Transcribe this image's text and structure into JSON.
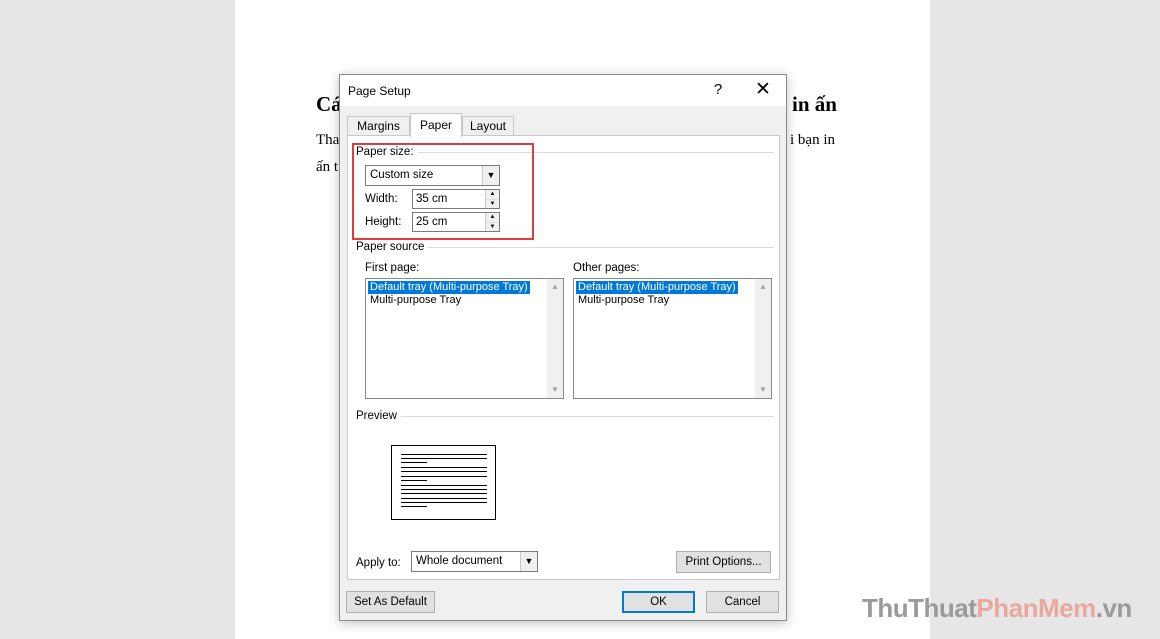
{
  "document": {
    "heading_left": "Cá",
    "heading_right": "in ấn",
    "line1_left": "Tha",
    "line2_left": "ấn t",
    "line1_right": "i bạn in"
  },
  "dialog": {
    "title": "Page Setup",
    "help_label": "?",
    "close_label": "✕",
    "tabs": [
      {
        "label": "Margins",
        "active": false
      },
      {
        "label": "Paper",
        "active": true
      },
      {
        "label": "Layout",
        "active": false
      }
    ],
    "paper_size": {
      "group_label": "Paper size:",
      "selected": "Custom size",
      "width_label": "Width:",
      "width_value": "35 cm",
      "height_label": "Height:",
      "height_value": "25 cm",
      "highlight_color": "#e03c3c"
    },
    "paper_source": {
      "group_label": "Paper source",
      "first_page_label": "First page:",
      "first_page_items": [
        "Default tray (Multi-purpose Tray)",
        "Multi-purpose Tray"
      ],
      "other_pages_label": "Other pages:",
      "other_pages_items": [
        "Default tray (Multi-purpose Tray)",
        "Multi-purpose Tray"
      ],
      "selected_color": "#0078d7"
    },
    "preview": {
      "group_label": "Preview"
    },
    "apply_to": {
      "label": "Apply to:",
      "selected": "Whole document"
    },
    "buttons": {
      "print_options": "Print Options...",
      "set_as_default": "Set As Default",
      "ok": "OK",
      "cancel": "Cancel"
    }
  },
  "watermark": {
    "part1": "ThuThuat",
    "part2": "PhanMem",
    "part3": ".vn"
  }
}
